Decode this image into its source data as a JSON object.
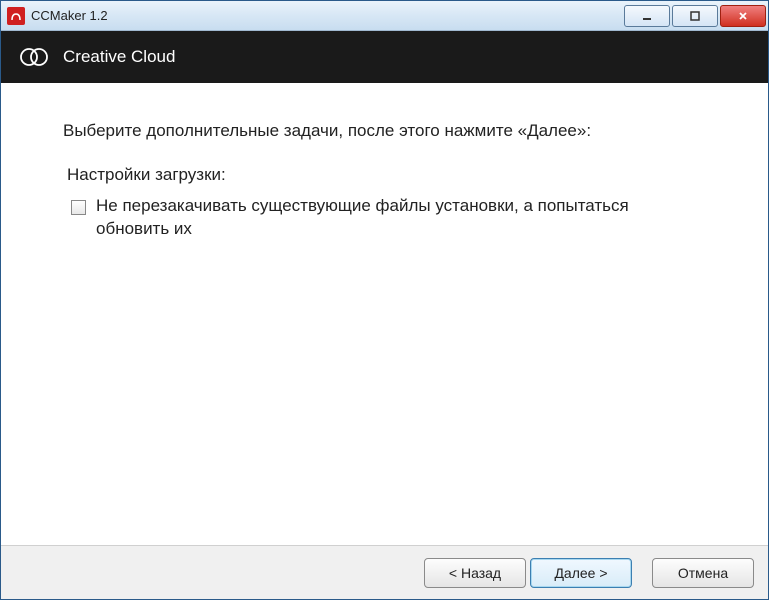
{
  "titlebar": {
    "title": "CCMaker 1.2",
    "icon_name": "app-icon"
  },
  "header": {
    "title": "Creative Cloud",
    "icon_name": "creative-cloud-icon"
  },
  "content": {
    "instruction": "Выберите дополнительные задачи, после этого нажмите «Далее»:",
    "section_label": "Настройки загрузки:",
    "checkbox_label": "Не перезакачивать существующие файлы установки, а попытаться обновить их"
  },
  "footer": {
    "back": "< Назад",
    "next": "Далее >",
    "cancel": "Отмена"
  },
  "window_controls": {
    "minimize": "–",
    "maximize": "❐",
    "close": "✕"
  }
}
